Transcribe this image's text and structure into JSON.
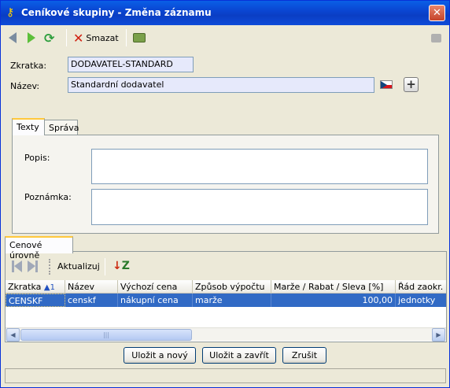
{
  "window": {
    "title": "Ceníkové skupiny - Změna záznamu",
    "close_glyph": "✕",
    "accent_color": "#0a46d2",
    "title_icon": "key-icon"
  },
  "toolbar": {
    "delete_label": "Smazat",
    "icons": [
      "back-arrow-icon",
      "forward-arrow-icon",
      "refresh-icon",
      "delete-x-icon",
      "print-icon",
      "message-icon"
    ]
  },
  "form": {
    "zkratka_label": "Zkratka:",
    "zkratka_value": "DODAVATEL-STANDARD",
    "nazev_label": "Název:",
    "nazev_value": "Standardní dodavatel",
    "plus_glyph": "+"
  },
  "tabs": {
    "texty": "Texty",
    "sprava": "Správa",
    "popis_label": "Popis:",
    "poznamka_label": "Poznámka:"
  },
  "price_levels": {
    "tab_label": "Cenové úrovně",
    "refresh_label": "Aktualizuj",
    "columns": [
      "Zkratka",
      "Název",
      "Výchozí cena",
      "Způsob výpočtu",
      "Marže / Rabat / Sleva [%]",
      "Řád zaokr. c"
    ],
    "sort_marker": "▲1",
    "rows": [
      {
        "zkratka": "CENSKF",
        "nazev": "censkf",
        "vychozi_cena": "nákupní cena",
        "zpusob": "marže",
        "marze": "100,00",
        "rad": "jednotky"
      }
    ]
  },
  "buttons": {
    "save_new": "Uložit a nový",
    "save_close": "Uložit a zavřít",
    "cancel": "Zrušit"
  },
  "scrollbar": {
    "left_glyph": "◀",
    "right_glyph": "▶",
    "grip": "|||"
  }
}
